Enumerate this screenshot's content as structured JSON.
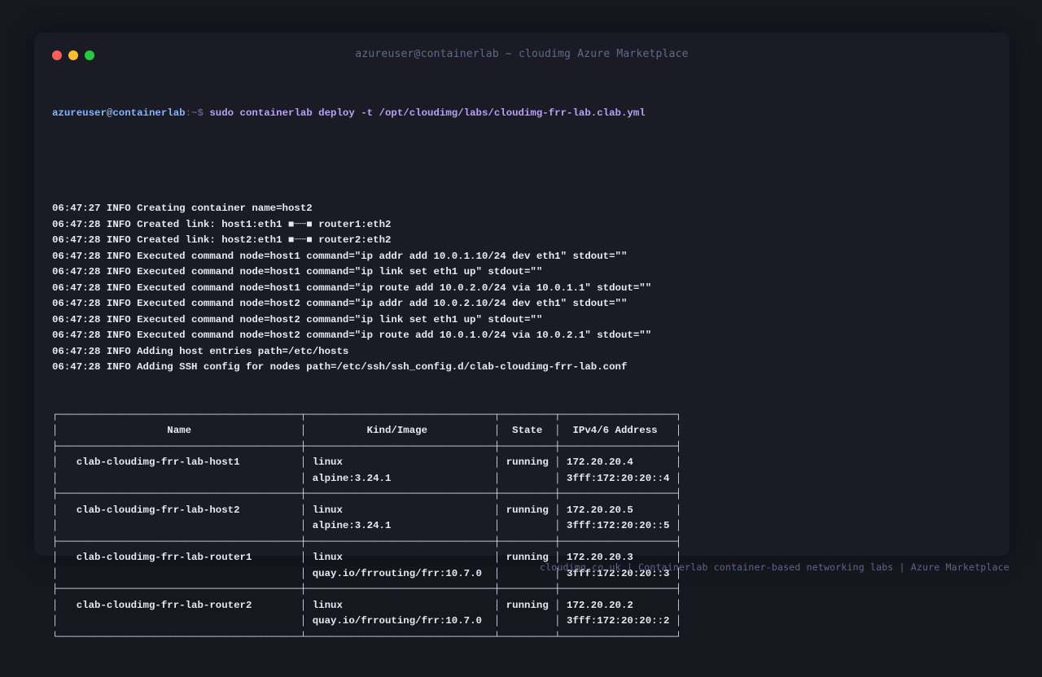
{
  "window": {
    "title": "azureuser@containerlab ~ cloudimg Azure Marketplace"
  },
  "prompt": {
    "user_host": "azureuser@containerlab",
    "path_symbol": ":~$",
    "command": "sudo containerlab deploy -t /opt/cloudimg/labs/cloudimg-frr-lab.clab.yml"
  },
  "logs": [
    "06:47:27 INFO Creating container name=host2",
    "06:47:28 INFO Created link: host1:eth1 ■┈┈■ router1:eth2",
    "06:47:28 INFO Created link: host2:eth1 ■┈┈■ router2:eth2",
    "06:47:28 INFO Executed command node=host1 command=\"ip addr add 10.0.1.10/24 dev eth1\" stdout=\"\"",
    "06:47:28 INFO Executed command node=host1 command=\"ip link set eth1 up\" stdout=\"\"",
    "06:47:28 INFO Executed command node=host1 command=\"ip route add 10.0.2.0/24 via 10.0.1.1\" stdout=\"\"",
    "06:47:28 INFO Executed command node=host2 command=\"ip addr add 10.0.2.10/24 dev eth1\" stdout=\"\"",
    "06:47:28 INFO Executed command node=host2 command=\"ip link set eth1 up\" stdout=\"\"",
    "06:47:28 INFO Executed command node=host2 command=\"ip route add 10.0.1.0/24 via 10.0.2.1\" stdout=\"\"",
    "06:47:28 INFO Adding host entries path=/etc/hosts",
    "06:47:28 INFO Adding SSH config for nodes path=/etc/ssh/ssh_config.d/clab-cloudimg-frr-lab.conf"
  ],
  "table": {
    "headers": [
      "Name",
      "Kind/Image",
      "State",
      "IPv4/6 Address"
    ],
    "rows": [
      {
        "name": "clab-cloudimg-frr-lab-host1",
        "kind": "linux",
        "image": "alpine:3.24.1",
        "state": "running",
        "ipv4": "172.20.20.4",
        "ipv6": "3fff:172:20:20::4"
      },
      {
        "name": "clab-cloudimg-frr-lab-host2",
        "kind": "linux",
        "image": "alpine:3.24.1",
        "state": "running",
        "ipv4": "172.20.20.5",
        "ipv6": "3fff:172:20:20::5"
      },
      {
        "name": "clab-cloudimg-frr-lab-router1",
        "kind": "linux",
        "image": "quay.io/frrouting/frr:10.7.0",
        "state": "running",
        "ipv4": "172.20.20.3",
        "ipv6": "3fff:172:20:20::3"
      },
      {
        "name": "clab-cloudimg-frr-lab-router2",
        "kind": "linux",
        "image": "quay.io/frrouting/frr:10.7.0",
        "state": "running",
        "ipv4": "172.20.20.2",
        "ipv6": "3fff:172:20:20::2"
      }
    ]
  },
  "footer": "cloudimg.co.uk | Containerlab container-based networking labs | Azure Marketplace",
  "colors": {
    "background": "#16171f",
    "window": "#1a1b25",
    "prompt_user": "#8ab4f8",
    "command": "#b9a2f2",
    "close": "#ff5f57",
    "minimize": "#febc2e",
    "maximize": "#28c840"
  }
}
